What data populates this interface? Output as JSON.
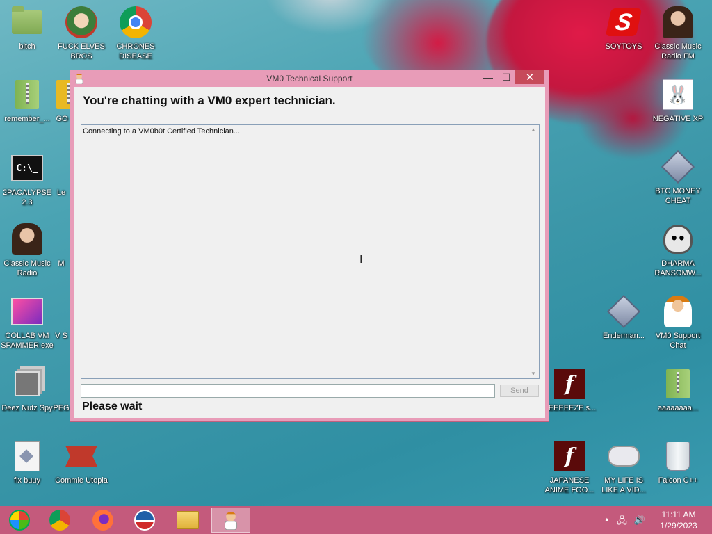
{
  "desktop": {
    "icons_left": [
      {
        "label": "bitch",
        "icon": "folder-icon"
      },
      {
        "label": "FUCK ELVES BROS",
        "icon": "elf-icon"
      },
      {
        "label": "CHRONES DISEASE",
        "icon": "chrome-icon"
      },
      {
        "label": "remember_...",
        "icon": "zip-folder-icon"
      },
      {
        "label": "GO",
        "icon": "partial-icon"
      },
      {
        "label": "2PACALYPSE 2.3",
        "icon": "cmd-icon"
      },
      {
        "label": "Le",
        "icon": "partial-icon"
      },
      {
        "label": "Classic Music Radio",
        "icon": "portrait-icon"
      },
      {
        "label": "M",
        "icon": "partial-icon"
      },
      {
        "label": "COLLAB VM SPAMMER.exe",
        "icon": "collab-icon"
      },
      {
        "label": "V S",
        "icon": "partial-icon"
      },
      {
        "label": "Deez Nutz Spy",
        "icon": "stacked-windows-icon"
      },
      {
        "label": "PEG",
        "icon": "partial-icon"
      },
      {
        "label": "fix buuy",
        "icon": "document-icon"
      },
      {
        "label": "Commie Utopia",
        "icon": "commie-icon"
      }
    ],
    "icons_right": [
      {
        "label": "SOYTOYS",
        "icon": "soytoys-icon"
      },
      {
        "label": "Classic Music Radio FM",
        "icon": "portrait-icon"
      },
      {
        "label": "NEGATIVE XP",
        "icon": "bunny-icon"
      },
      {
        "label": "BTC MONEY CHEAT",
        "icon": "gem-icon"
      },
      {
        "label": "DHARMA RANSOMW...",
        "icon": "skull-icon"
      },
      {
        "label": "Enderman...",
        "icon": "gem-icon"
      },
      {
        "label": "VM0 Support Chat",
        "icon": "technician-icon"
      },
      {
        "label": "REEEEEZE.s...",
        "icon": "flash-icon"
      },
      {
        "label": "aaaaaaaa...",
        "icon": "zip-folder-icon"
      },
      {
        "label": "JAPANESE ANIME FOO...",
        "icon": "flash-icon"
      },
      {
        "label": "MY LIFE IS LIKE A VID...",
        "icon": "gamepad-icon"
      },
      {
        "label": "Falcon C++",
        "icon": "trash-icon"
      }
    ]
  },
  "window": {
    "title": "VM0 Technical Support",
    "min_glyph": "—",
    "max_glyph": "☐",
    "close_glyph": "✕",
    "heading": "You're chatting with a VM0 expert technician.",
    "chat_log": "Connecting to a VM0b0t Certified Technician...",
    "input_value": "",
    "send_label": "Send",
    "status": "Please wait"
  },
  "taskbar": {
    "items": [
      "start-orb-icon",
      "chrome-icon",
      "firefox-icon",
      "obama-icon",
      "file-explorer-icon",
      "vm0-support-icon"
    ],
    "tray_arrow": "▲",
    "clock_time": "11:11 AM",
    "clock_date": "1/29/2023"
  },
  "colors": {
    "titlebar": "#e89cb8",
    "close_button": "#c74a5a",
    "taskbar": "#c45a7c",
    "client_bg": "#f0f0f0"
  }
}
